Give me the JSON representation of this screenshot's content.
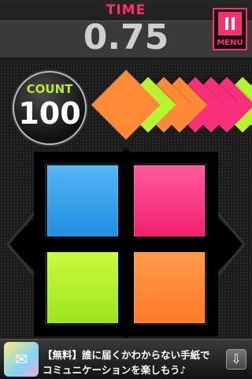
{
  "header": {
    "time_label": "TIME",
    "time_value": "0.75",
    "menu_label": "MENU",
    "menu_icon": "pause-icon"
  },
  "counter": {
    "label": "COUNT",
    "value": "100"
  },
  "queue": {
    "tiles": [
      "orange",
      "green",
      "orange",
      "orange",
      "pink",
      "pink",
      "pink",
      "green",
      "orange",
      "pink"
    ]
  },
  "pads": [
    {
      "name": "blue",
      "color": "#2aa0ef"
    },
    {
      "name": "pink",
      "color": "#f8307c"
    },
    {
      "name": "green",
      "color": "#b4f52b"
    },
    {
      "name": "orange",
      "color": "#ff8a36"
    }
  ],
  "colors": {
    "orange": "#ff8a36",
    "green": "#b4f52b",
    "pink": "#f8307c",
    "blue": "#2aa0ef",
    "accent": "#ff2f6d"
  },
  "ad": {
    "line1": "【無料】誰に届くかわからない手紙で",
    "line2": "コミュニケーションを楽しもう♪",
    "icon": "app-icon",
    "icon_glyph": "✉",
    "download_icon": "download-icon",
    "download_glyph": "⇩"
  }
}
